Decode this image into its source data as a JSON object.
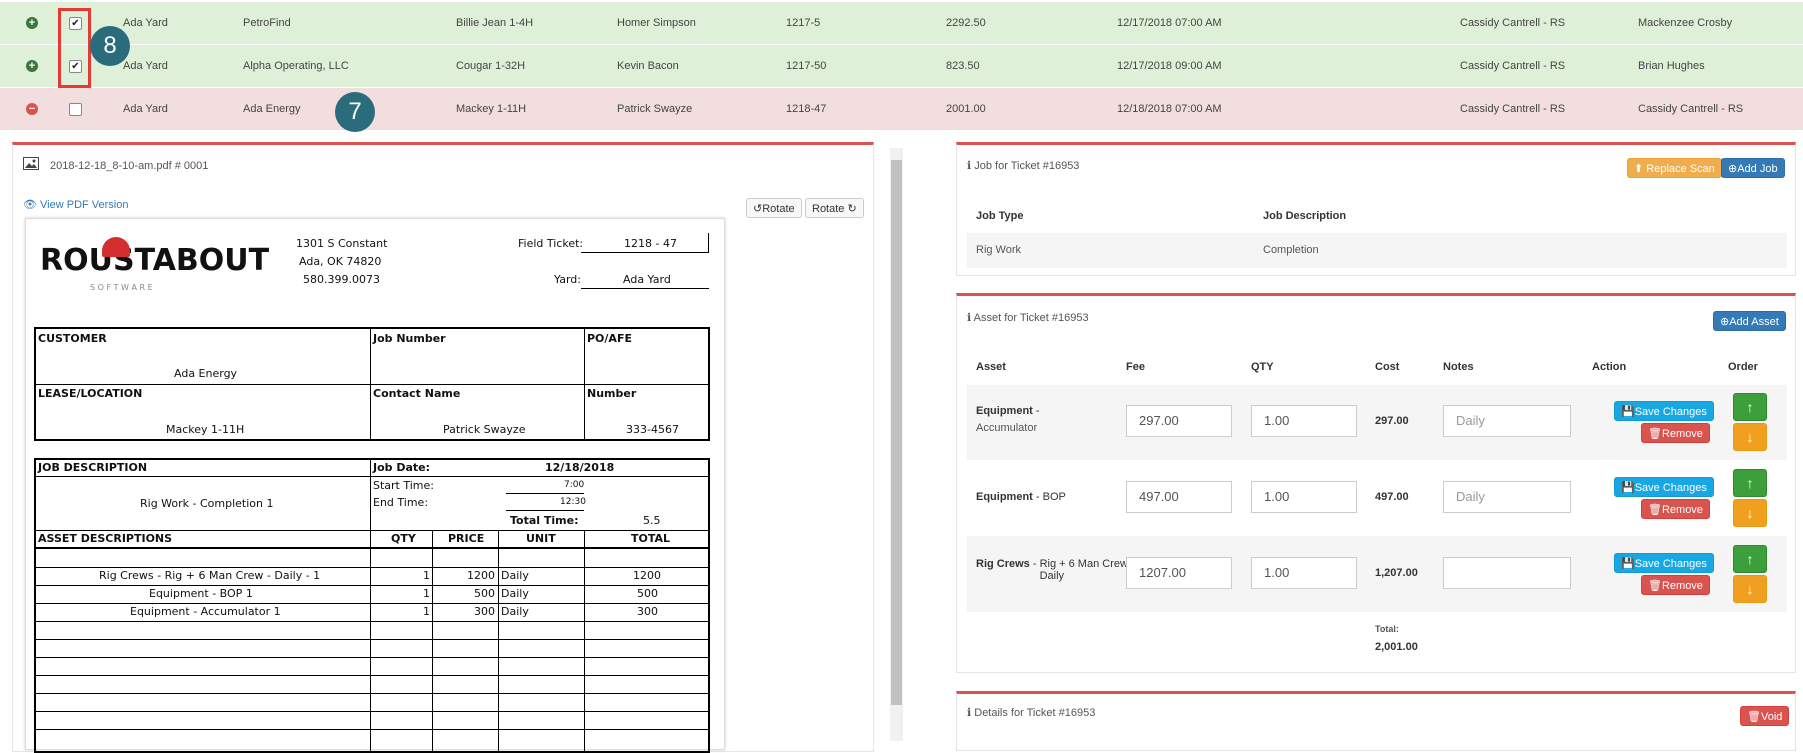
{
  "rows": [
    {
      "status": "plus",
      "checked": true,
      "yard": "Ada Yard",
      "customer": "PetroFind",
      "lease": "Billie Jean 1-4H",
      "contact": "Homer Simpson",
      "ticket": "1217-5",
      "amount": "2292.50",
      "date": "12/17/2018 07:00 AM",
      "office": "Cassidy Cantrell - RS",
      "assigned": "Mackenzee Crosby",
      "color": "#dff0d8"
    },
    {
      "status": "plus",
      "checked": true,
      "yard": "Ada Yard",
      "customer": "Alpha Operating, LLC",
      "lease": "Cougar 1-32H",
      "contact": "Kevin Bacon",
      "ticket": "1217-50",
      "amount": "823.50",
      "date": "12/17/2018 09:00 AM",
      "office": "Cassidy Cantrell - RS",
      "assigned": "Brian Hughes",
      "color": "#dff0d8"
    },
    {
      "status": "minus",
      "checked": false,
      "yard": "Ada Yard",
      "customer": "Ada Energy",
      "lease": "Mackey 1-11H",
      "contact": "Patrick Swayze",
      "ticket": "1218-47",
      "amount": "2001.00",
      "date": "12/18/2018 07:00 AM",
      "office": "Cassidy Cantrell - RS",
      "assigned": "Cassidy Cantrell - RS",
      "color": "#f2dede"
    }
  ],
  "badges": {
    "eight": "8",
    "seven": "7"
  },
  "scan": {
    "filename": "2018-12-18_8-10-am.pdf # 0001",
    "view_pdf": "View PDF Version",
    "rotate_left": "Rotate",
    "rotate_right": "Rotate"
  },
  "ticket_doc": {
    "logo_main": "ROUSTABOUT",
    "logo_sub": "S O F T W A R E",
    "address1": "1301 S Constant",
    "address2": "Ada, OK 74820",
    "phone": "580.399.0073",
    "field_ticket_label": "Field Ticket:",
    "field_ticket": "1218 - 47",
    "yard_label": "Yard:",
    "yard": "Ada Yard",
    "customer_label": "CUSTOMER",
    "customer": "Ada Energy",
    "job_number_label": "Job Number",
    "po_label": "PO/AFE",
    "lease_label": "LEASE/LOCATION",
    "lease": "Mackey 1-11H",
    "contact_label": "Contact Name",
    "contact": "Patrick Swayze",
    "number_label": "Number",
    "number": "333-4567",
    "job_desc_label": "JOB DESCRIPTION",
    "job_date_label": "Job Date:",
    "job_date": "12/18/2018",
    "job_desc": "Rig Work - Completion 1",
    "start_label": "Start Time:",
    "start": "7:00",
    "end_label": "End Time:",
    "end": "12:30",
    "total_time_label": "Total Time:",
    "total_time": "5.5",
    "asset_header": "ASSET DESCRIPTIONS",
    "qty_header": "QTY",
    "price_header": "PRICE",
    "unit_header": "UNIT",
    "total_header": "TOTAL",
    "assets": [
      {
        "desc": "Rig Crews - Rig + 6 Man Crew - Daily - 1",
        "qty": "1",
        "price": "1200",
        "unit": "Daily",
        "total": "1200"
      },
      {
        "desc": "Equipment - BOP 1",
        "qty": "1",
        "price": "500",
        "unit": "Daily",
        "total": "500"
      },
      {
        "desc": "Equipment - Accumulator 1",
        "qty": "1",
        "price": "300",
        "unit": "Daily",
        "total": "300"
      }
    ]
  },
  "job_panel": {
    "title": "Job for Ticket #16953",
    "replace_scan": "Replace Scan",
    "add_job": "Add Job",
    "col_type": "Job Type",
    "col_desc": "Job Description",
    "type": "Rig Work",
    "desc": "Completion"
  },
  "asset_panel": {
    "title": "Asset for Ticket #16953",
    "add_asset": "Add Asset",
    "headers": {
      "asset": "Asset",
      "fee": "Fee",
      "qty": "QTY",
      "cost": "Cost",
      "notes": "Notes",
      "action": "Action",
      "order": "Order"
    },
    "items": [
      {
        "name": "Equipment",
        "sub": "Accumulator",
        "fee": "297.00",
        "qty": "1.00",
        "cost": "297.00",
        "notes": "Daily"
      },
      {
        "name": "Equipment",
        "sub": "BOP",
        "fee": "497.00",
        "qty": "1.00",
        "cost": "497.00",
        "notes": "Daily"
      },
      {
        "name": "Rig Crews",
        "sub": "Rig + 6 Man Crew - Daily",
        "fee": "1207.00",
        "qty": "1.00",
        "cost": "1,207.00",
        "notes": ""
      }
    ],
    "save": "Save Changes",
    "remove": "Remove",
    "total_label": "Total:",
    "total": "2,001.00"
  },
  "details_panel": {
    "title": "Details for Ticket #16953",
    "void": "Void"
  }
}
